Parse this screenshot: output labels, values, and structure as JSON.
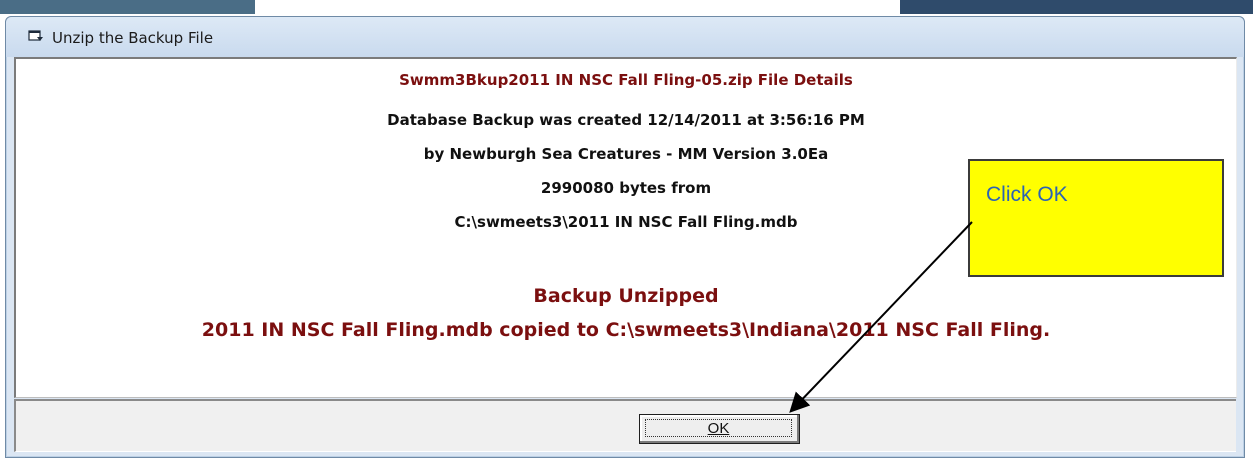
{
  "window": {
    "title": "Unzip the Backup File"
  },
  "details": {
    "heading": "Swmm3Bkup2011 IN NSC Fall Fling-05.zip  File Details",
    "created": "Database Backup was created 12/14/2011 at 3:56:16 PM",
    "by": "by Newburgh Sea Creatures - MM Version 3.0Ea",
    "size": "2990080 bytes from",
    "source_path": "C:\\swmeets3\\2011 IN NSC Fall Fling.mdb"
  },
  "status": {
    "title": "Backup Unzipped",
    "message": "2011 IN NSC Fall Fling.mdb copied to C:\\swmeets3\\Indiana\\2011 NSC Fall Fling."
  },
  "buttons": {
    "ok_label": "OK"
  },
  "annotation": {
    "callout_text": "Click OK"
  },
  "colors": {
    "heading_text": "#7b0f0f",
    "callout_fill": "#ffff00",
    "callout_text": "#2b63b5"
  },
  "icons": {
    "title_icon": "window-app-icon"
  }
}
